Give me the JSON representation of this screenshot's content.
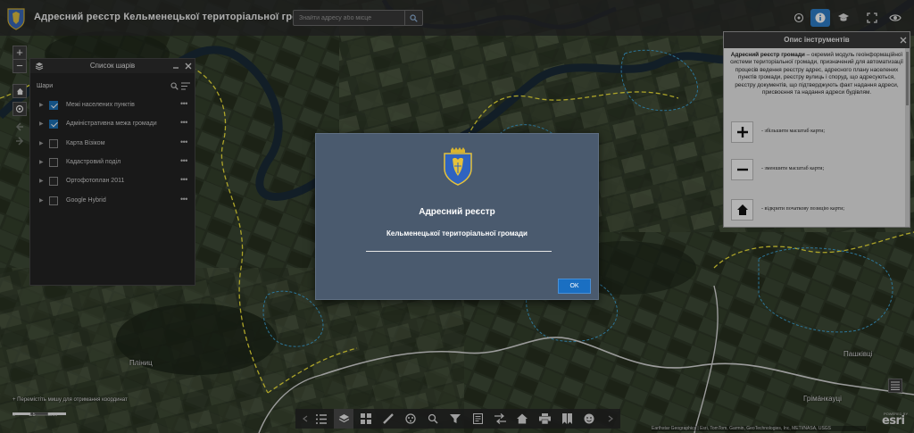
{
  "header": {
    "title": "Адресний реєстр Кельменецької територіальної громади",
    "search_placeholder": "Знайти адресу або місце"
  },
  "header_buttons": [
    {
      "icon": "locate-icon"
    },
    {
      "icon": "info-icon"
    },
    {
      "icon": "graduation-cap-icon"
    },
    {
      "icon": "fullscreen-icon"
    },
    {
      "icon": "eye-icon"
    }
  ],
  "map_controls": {
    "zoom_in": "+",
    "zoom_out": "−"
  },
  "layer_list": {
    "title": "Список шарів",
    "subtitle": "Шари",
    "layers": [
      {
        "label": "Межі населених пунктів",
        "checked": true
      },
      {
        "label": "Адміністративна межа громади",
        "checked": true
      },
      {
        "label": "Карта Візіком",
        "checked": false
      },
      {
        "label": "Кадастровий поділ",
        "checked": false
      },
      {
        "label": "Ортофотоплан 2011",
        "checked": false
      },
      {
        "label": "Google Hybrid",
        "checked": false
      }
    ],
    "more_label": "•••"
  },
  "tools_panel": {
    "title": "Опис інструментів",
    "intro_bold": "Адресний реєстр громади",
    "intro_text": " – окремий модуль геоінформаційної системи територіальної громади, призначений для автоматизації процесів ведення реєстру адрес, адресного плану населених пунктів громади, реєстру вулиць і споруд, що адресуються, реєстру документів, що підтверджують факт надання адреси, присвоєння та надання адреси будівлям.",
    "items": [
      {
        "icon": "plus-icon",
        "text": "- збільшити масштаб карти;"
      },
      {
        "icon": "minus-icon",
        "text": "- зменшити масштаб карти;"
      },
      {
        "icon": "home-icon",
        "text": "- відкрити початкову позицію карти;"
      }
    ]
  },
  "modal": {
    "title": "Адресний реєстр",
    "subtitle": "Кельменецької територіальної громади",
    "ok_label": "OK"
  },
  "toolbar": [
    {
      "icon": "list-icon"
    },
    {
      "icon": "layers-icon",
      "active": true
    },
    {
      "icon": "basemap-gallery-icon"
    },
    {
      "icon": "measure-icon"
    },
    {
      "icon": "identify-icon"
    },
    {
      "icon": "query-icon"
    },
    {
      "icon": "filter-icon"
    },
    {
      "icon": "edit-icon"
    },
    {
      "icon": "swipe-icon"
    },
    {
      "icon": "home-icon"
    },
    {
      "icon": "print-icon"
    },
    {
      "icon": "bookmark-icon"
    },
    {
      "icon": "about-icon"
    }
  ],
  "map": {
    "coord_hint": "Перемістіть мишу для отримання координат",
    "scale_labels": [
      "0",
      "1.5",
      "3km"
    ],
    "attribution": "Earthstar Geographics | Esri, TomTom, Garmin, GeoTechnologies, Inc, METI/NASA, USGS",
    "esri_powered": "POWERED BY",
    "esri_logo": "esri",
    "place_labels": [
      "Пашківці",
      "Грімáнкауці",
      "Пліниц"
    ]
  },
  "colors": {
    "header_bg": "#282828",
    "modal_bg": "#4a5a6e",
    "ok_button": "#1a6fc2",
    "community_boundary": "#f0e43a",
    "settlement_boundary": "#3fa3d4",
    "road_color": "#d8d8d8",
    "river_color": "#1a2a36"
  }
}
